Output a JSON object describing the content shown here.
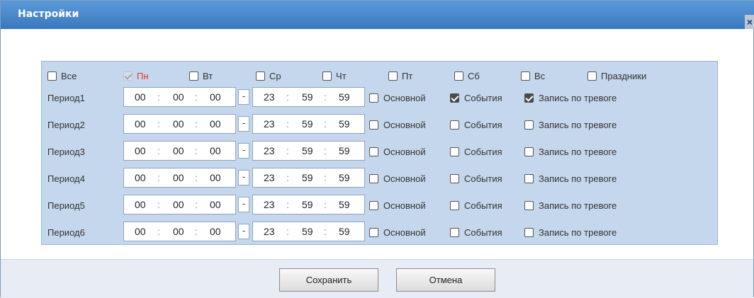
{
  "dialog": {
    "title": "Настройки",
    "close_glyph": "×"
  },
  "days": [
    {
      "label": "Все",
      "checked": false,
      "disabled": false,
      "highlight": false
    },
    {
      "label": "Пн",
      "checked": true,
      "disabled": true,
      "highlight": true
    },
    {
      "label": "Вт",
      "checked": false,
      "disabled": false,
      "highlight": false
    },
    {
      "label": "Ср",
      "checked": false,
      "disabled": false,
      "highlight": false
    },
    {
      "label": "Чт",
      "checked": false,
      "disabled": false,
      "highlight": false
    },
    {
      "label": "Пт",
      "checked": false,
      "disabled": false,
      "highlight": false
    },
    {
      "label": "Сб",
      "checked": false,
      "disabled": false,
      "highlight": false
    },
    {
      "label": "Вс",
      "checked": false,
      "disabled": false,
      "highlight": false
    },
    {
      "label": "Праздники",
      "checked": false,
      "disabled": false,
      "highlight": false
    }
  ],
  "periods": [
    {
      "label": "Период1",
      "start": [
        "00",
        "00",
        "00"
      ],
      "end": [
        "23",
        "59",
        "59"
      ],
      "main": false,
      "events": true,
      "alarm": true
    },
    {
      "label": "Период2",
      "start": [
        "00",
        "00",
        "00"
      ],
      "end": [
        "23",
        "59",
        "59"
      ],
      "main": false,
      "events": false,
      "alarm": false
    },
    {
      "label": "Период3",
      "start": [
        "00",
        "00",
        "00"
      ],
      "end": [
        "23",
        "59",
        "59"
      ],
      "main": false,
      "events": false,
      "alarm": false
    },
    {
      "label": "Период4",
      "start": [
        "00",
        "00",
        "00"
      ],
      "end": [
        "23",
        "59",
        "59"
      ],
      "main": false,
      "events": false,
      "alarm": false
    },
    {
      "label": "Период5",
      "start": [
        "00",
        "00",
        "00"
      ],
      "end": [
        "23",
        "59",
        "59"
      ],
      "main": false,
      "events": false,
      "alarm": false
    },
    {
      "label": "Период6",
      "start": [
        "00",
        "00",
        "00"
      ],
      "end": [
        "23",
        "59",
        "59"
      ],
      "main": false,
      "events": false,
      "alarm": false
    }
  ],
  "options": {
    "main": "Основной",
    "events": "События",
    "alarm": "Запись по тревоге"
  },
  "separators": {
    "range": "-",
    "time": ":"
  },
  "buttons": {
    "save": "Сохранить",
    "cancel": "Отмена"
  },
  "colors": {
    "title_bar": "#3a78be",
    "panel": "#c5d7ec",
    "highlight_day": "#e33333"
  }
}
